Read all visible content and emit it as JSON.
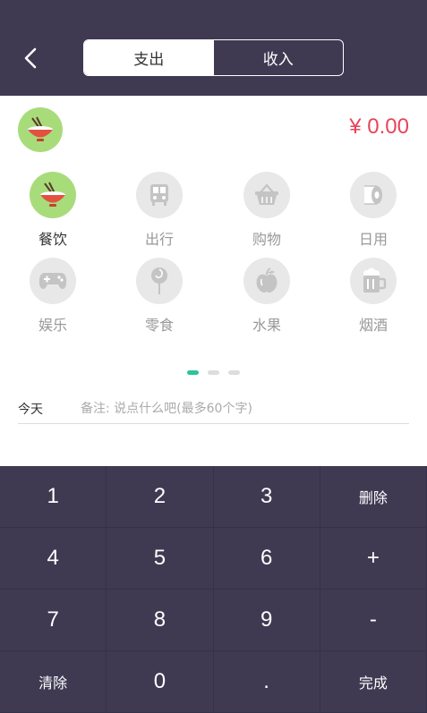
{
  "header": {
    "tabs": [
      {
        "label": "支出",
        "active": true
      },
      {
        "label": "收入",
        "active": false
      }
    ]
  },
  "amount": "¥ 0.00",
  "categories": [
    {
      "label": "餐饮",
      "icon": "bowl-icon",
      "active": true
    },
    {
      "label": "出行",
      "icon": "bus-icon",
      "active": false
    },
    {
      "label": "购物",
      "icon": "basket-icon",
      "active": false
    },
    {
      "label": "日用",
      "icon": "toilet-paper-icon",
      "active": false
    },
    {
      "label": "娱乐",
      "icon": "gamepad-icon",
      "active": false
    },
    {
      "label": "零食",
      "icon": "lollipop-icon",
      "active": false
    },
    {
      "label": "水果",
      "icon": "apple-icon",
      "active": false
    },
    {
      "label": "烟酒",
      "icon": "beer-icon",
      "active": false
    }
  ],
  "note": {
    "date": "今天",
    "placeholder": "备注: 说点什么吧(最多60个字)"
  },
  "keypad": [
    "1",
    "2",
    "3",
    "删除",
    "4",
    "5",
    "6",
    "+",
    "7",
    "8",
    "9",
    "-",
    "清除",
    "0",
    ".",
    "完成"
  ],
  "colors": {
    "header": "#3f3a52",
    "accent_green": "#a8dc7b",
    "amount_red": "#e8445a",
    "dot_active": "#2bc49a"
  }
}
